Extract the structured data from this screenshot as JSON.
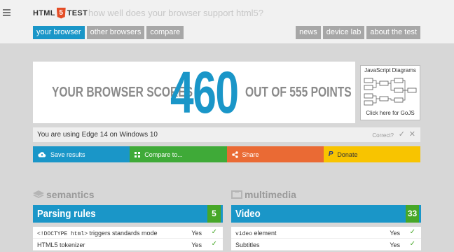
{
  "header": {
    "logo_left": "HTML",
    "logo_shield": "5",
    "logo_right": "TEST",
    "tagline": "how well does your browser support html5?",
    "menu_icon": "hamburger-icon"
  },
  "nav_left": [
    "your browser",
    "other browsers",
    "compare"
  ],
  "nav_right": [
    "news",
    "device lab",
    "about the test"
  ],
  "score": {
    "prefix": "YOUR BROWSER SCORES",
    "value": "460",
    "suffix": "OUT OF 555 POINTS"
  },
  "ad": {
    "title": "JavaScript Diagrams",
    "cta": "Click here for GoJS"
  },
  "user_agent": {
    "text": "You are using Edge 14 on Windows 10",
    "correct_label": "Correct?"
  },
  "actions": [
    {
      "label": "Save results",
      "icon": "cloud-upload-icon",
      "color": "#1a96c8"
    },
    {
      "label": "Compare to...",
      "icon": "grid-icon",
      "color": "#3faa38"
    },
    {
      "label": "Share",
      "icon": "share-icon",
      "color": "#ea6a34"
    },
    {
      "label": "Donate",
      "icon": "paypal-icon",
      "color": "#f8c400"
    }
  ],
  "sections": [
    {
      "title": "semantics",
      "icon": "semantics-icon",
      "category": "Parsing rules",
      "points": "5",
      "rows": [
        {
          "code": "<!DOCTYPE html>",
          "text": " triggers standards mode",
          "result": "Yes"
        },
        {
          "code": "",
          "text": "HTML5 tokenizer",
          "result": "Yes"
        }
      ]
    },
    {
      "title": "multimedia",
      "icon": "multimedia-icon",
      "category": "Video",
      "points": "33",
      "rows": [
        {
          "code": "video",
          "text": " element",
          "result": "Yes"
        },
        {
          "code": "",
          "text": "Subtitles",
          "result": "Yes"
        }
      ]
    }
  ]
}
